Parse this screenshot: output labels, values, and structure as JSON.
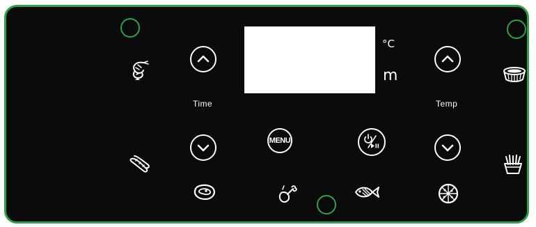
{
  "panel": {
    "accent_color": "#2fa04a",
    "background_color": "#0b0b0b"
  },
  "display": {
    "unit_temp": "°C",
    "unit_time": "m"
  },
  "labels": {
    "time": "Time",
    "temp": "Temp"
  },
  "buttons": {
    "time_up": "chevron-up-icon",
    "time_down": "chevron-down-icon",
    "temp_up": "chevron-up-icon",
    "temp_down": "chevron-down-icon",
    "menu": "MENU",
    "power_start_pause": "power-play-pause-icon"
  },
  "presets": [
    {
      "name": "shrimp",
      "icon": "shrimp-icon"
    },
    {
      "name": "sausage",
      "icon": "sausage-icon"
    },
    {
      "name": "steak",
      "icon": "steak-icon"
    },
    {
      "name": "chicken-leg",
      "icon": "chicken-leg-icon"
    },
    {
      "name": "fish",
      "icon": "fish-icon"
    },
    {
      "name": "pizza",
      "icon": "pizza-icon"
    },
    {
      "name": "cake",
      "icon": "cake-icon"
    },
    {
      "name": "fries",
      "icon": "fries-icon"
    }
  ]
}
